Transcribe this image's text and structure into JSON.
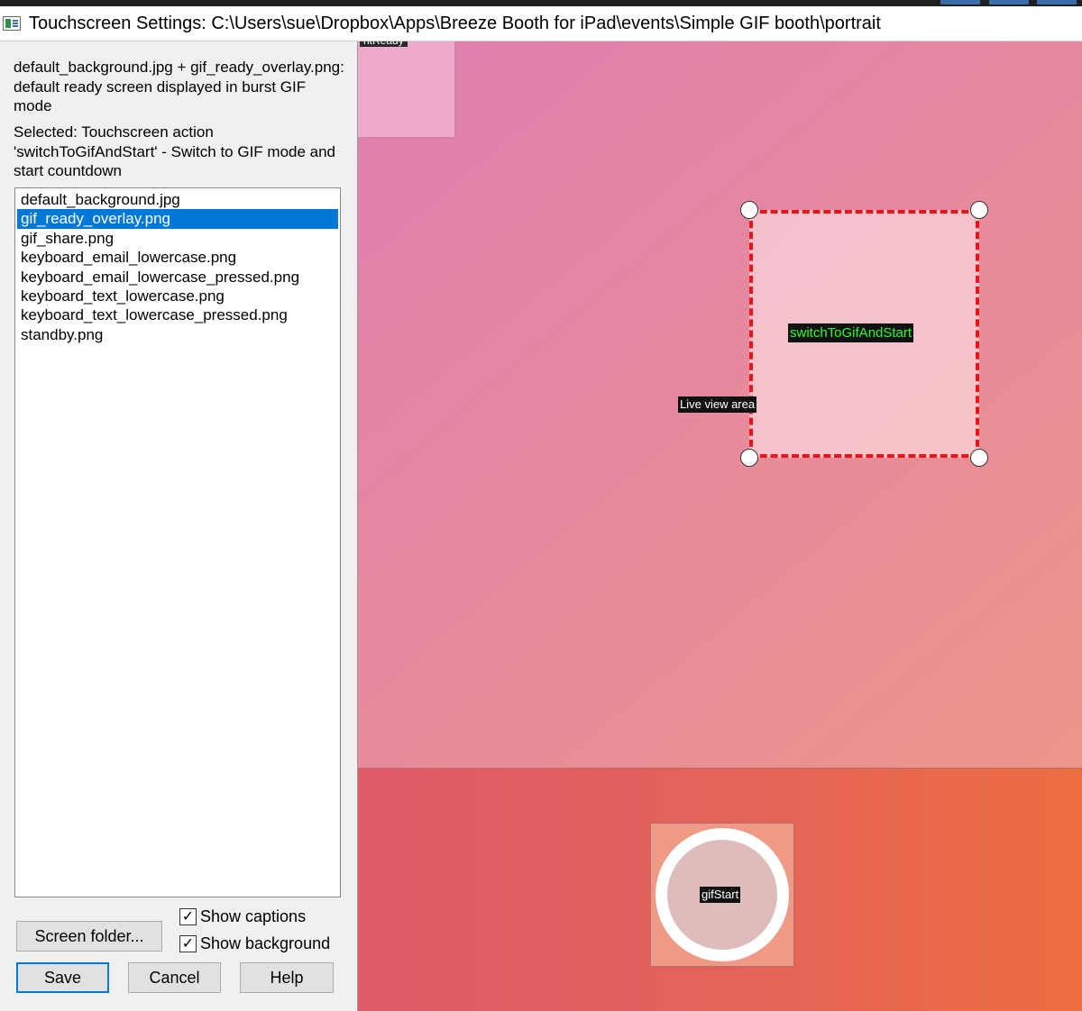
{
  "window": {
    "title": "Touchscreen Settings: C:\\Users\\sue\\Dropbox\\Apps\\Breeze Booth for iPad\\events\\Simple GIF booth\\portrait"
  },
  "left_panel": {
    "description": "default_background.jpg + gif_ready_overlay.png: default ready screen displayed in burst GIF mode",
    "selected_info": "Selected: Touchscreen action 'switchToGifAndStart' - Switch to GIF mode and start countdown",
    "files": [
      {
        "name": "default_background.jpg",
        "selected": false
      },
      {
        "name": "gif_ready_overlay.png",
        "selected": true
      },
      {
        "name": "gif_share.png",
        "selected": false
      },
      {
        "name": "keyboard_email_lowercase.png",
        "selected": false
      },
      {
        "name": "keyboard_email_lowercase_pressed.png",
        "selected": false
      },
      {
        "name": "keyboard_text_lowercase.png",
        "selected": false
      },
      {
        "name": "keyboard_text_lowercase_pressed.png",
        "selected": false
      },
      {
        "name": "standby.png",
        "selected": false
      }
    ],
    "screen_folder_label": "Screen folder...",
    "show_captions": {
      "label": "Show captions",
      "checked": true
    },
    "show_background": {
      "label": "Show background",
      "checked": true
    },
    "save_label": "Save",
    "cancel_label": "Cancel",
    "help_label": "Help"
  },
  "canvas": {
    "ready_tag": "ntReady",
    "selected_caption": "switchToGifAndStart",
    "live_view_caption": "Live view area",
    "gif_caption": "gifStart"
  },
  "colors": {
    "selection_blue": "#0078d7",
    "selection_dash": "#e8141a",
    "caption_green": "#2bff2b"
  }
}
